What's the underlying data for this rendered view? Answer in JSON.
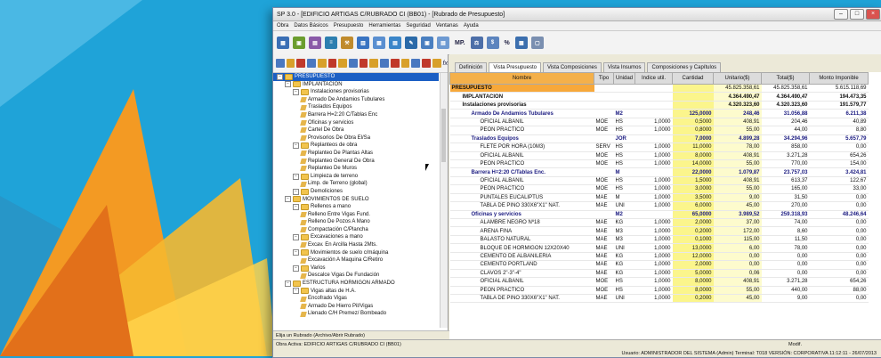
{
  "window": {
    "title": "SP 3.0 - [EDIFICIO ARTIGAS C/RUBRADO CI (BB01) - [Rubrado de Presupuesto]"
  },
  "menu": [
    "Obra",
    "Datos Básicos",
    "Presupuesto",
    "Herramientas",
    "Seguridad",
    "Ventanas",
    "Ayuda"
  ],
  "toolbar": {
    "mp_label": "MP.",
    "percent_label": "%"
  },
  "left_toolbar_fx": "fx",
  "tree": [
    {
      "label": "PRESUPUESTO",
      "level": 0,
      "type": "folder",
      "selected": true
    },
    {
      "label": "IMPLANTACION",
      "level": 1,
      "type": "folder"
    },
    {
      "label": "Instalaciones provisorias",
      "level": 2,
      "type": "folder"
    },
    {
      "label": "Armado De Andamios Tubulares",
      "level": 3,
      "type": "item"
    },
    {
      "label": "Traslados Equipos",
      "level": 3,
      "type": "item"
    },
    {
      "label": "Barrera H=2:20 C/Tablas Enc",
      "level": 3,
      "type": "item"
    },
    {
      "label": "Oficinas y servicios",
      "level": 3,
      "type": "item"
    },
    {
      "label": "Cartel De Obra",
      "level": 3,
      "type": "item"
    },
    {
      "label": "Provisorios De Obra El/Sa",
      "level": 3,
      "type": "item"
    },
    {
      "label": "Replanteos de obra",
      "level": 2,
      "type": "folder"
    },
    {
      "label": "Replanteo De Plantas Altas",
      "level": 3,
      "type": "item"
    },
    {
      "label": "Replanteo General De Obra",
      "level": 3,
      "type": "item"
    },
    {
      "label": "Replanteo De Muros",
      "level": 3,
      "type": "item"
    },
    {
      "label": "Limpieza de terreno",
      "level": 2,
      "type": "folder"
    },
    {
      "label": "Limp. de Terreno (global)",
      "level": 3,
      "type": "item"
    },
    {
      "label": "Demoliciones",
      "level": 2,
      "type": "folder"
    },
    {
      "label": "MOVIMIENTOS DE SUELO",
      "level": 1,
      "type": "folder"
    },
    {
      "label": "Rellenos a mano",
      "level": 2,
      "type": "folder"
    },
    {
      "label": "Relleno Entre Vigas Fund.",
      "level": 3,
      "type": "item"
    },
    {
      "label": "Relleno De Pozos A Mano",
      "level": 3,
      "type": "item"
    },
    {
      "label": "Compactación C/Plancha",
      "level": 3,
      "type": "item"
    },
    {
      "label": "Excavaciones a mano",
      "level": 2,
      "type": "folder"
    },
    {
      "label": "Excav. En Arcilla Hasta 2Mts.",
      "level": 3,
      "type": "item"
    },
    {
      "label": "Movimientos de suelo c/máquina",
      "level": 2,
      "type": "folder"
    },
    {
      "label": "Excavación A Maquina C/Retiro",
      "level": 3,
      "type": "item"
    },
    {
      "label": "Varios",
      "level": 2,
      "type": "folder"
    },
    {
      "label": "Descalce Vigas De Fundación",
      "level": 3,
      "type": "item"
    },
    {
      "label": "ESTRUCTURA HORMIGON ARMADO",
      "level": 1,
      "type": "folder"
    },
    {
      "label": "Vigas altas de H.A.",
      "level": 2,
      "type": "folder"
    },
    {
      "label": "Encofrado Vigas",
      "level": 3,
      "type": "item"
    },
    {
      "label": "Armado De Hierro Pil/Vigas",
      "level": 3,
      "type": "item"
    },
    {
      "label": "Llenado C/H Premez/ Bombeado",
      "level": 3,
      "type": "item"
    }
  ],
  "left_status": "Elija un Rubrado (Archivo/Abrir Rubrado)",
  "tabs": [
    "Definición",
    "Vista Presupuesto",
    "Vista Composiciones",
    "Vista Insumos",
    "Composiciones y Capítulos"
  ],
  "columns": [
    "Nombre",
    "Tipo",
    "Unidad",
    "Indice util.",
    "Cantidad",
    "Unitario($)",
    "Total($)",
    "Monto Imponible"
  ],
  "rows": [
    {
      "style": "head",
      "name": "PRESUPUESTO",
      "tipo": "",
      "unidad": "",
      "indice": "",
      "cantidad": "",
      "unitario": "45.825.358,61",
      "total": "45.825.358,61",
      "monto": "5.615.118,69"
    },
    {
      "style": "b1",
      "name": "IMPLANTACION",
      "tipo": "",
      "unidad": "",
      "indice": "",
      "cantidad": "",
      "unitario": "4.364.490,47",
      "total": "4.364.490,47",
      "monto": "194.473,35"
    },
    {
      "style": "b1",
      "name": "Instalaciones provisorias",
      "tipo": "",
      "unidad": "",
      "indice": "",
      "cantidad": "",
      "unitario": "4.320.323,60",
      "total": "4.320.323,60",
      "monto": "191.579,77"
    },
    {
      "style": "b2",
      "name": "Armado De Andamios Tubulares",
      "tipo": "",
      "unidad": "M2",
      "indice": "",
      "cantidad": "125,0000",
      "unitario": "248,46",
      "total": "31.056,88",
      "monto": "6.211,38"
    },
    {
      "style": "",
      "name": "OFICIAL ALBAÑIL",
      "tipo": "MOE",
      "unidad": "HS",
      "indice": "1,0000",
      "cantidad": "0,5000",
      "unitario": "408,91",
      "total": "204,46",
      "monto": "40,89"
    },
    {
      "style": "",
      "name": "PEON PRACTICO",
      "tipo": "MOE",
      "unidad": "HS",
      "indice": "1,0000",
      "cantidad": "0,8000",
      "unitario": "55,00",
      "total": "44,00",
      "monto": "8,80"
    },
    {
      "style": "b2",
      "name": "Traslados Equipos",
      "tipo": "",
      "unidad": "JOR",
      "indice": "",
      "cantidad": "7,0000",
      "unitario": "4.899,28",
      "total": "34.294,96",
      "monto": "5.657,79"
    },
    {
      "style": "",
      "name": "FLETE POR HORA (10M3)",
      "tipo": "SERV",
      "unidad": "HS",
      "indice": "1,0000",
      "cantidad": "11,0000",
      "unitario": "78,00",
      "total": "858,00",
      "monto": "0,00"
    },
    {
      "style": "",
      "name": "OFICIAL ALBAÑIL",
      "tipo": "MOE",
      "unidad": "HS",
      "indice": "1,0000",
      "cantidad": "8,0000",
      "unitario": "408,91",
      "total": "3.271,28",
      "monto": "654,26"
    },
    {
      "style": "",
      "name": "PEON PRACTICO",
      "tipo": "MOE",
      "unidad": "HS",
      "indice": "1,0000",
      "cantidad": "14,0000",
      "unitario": "55,00",
      "total": "770,00",
      "monto": "154,00"
    },
    {
      "style": "b2",
      "name": "Barrera H=2:20 C/Tablas Enc.",
      "tipo": "",
      "unidad": "M",
      "indice": "",
      "cantidad": "22,0000",
      "unitario": "1.079,87",
      "total": "23.757,03",
      "monto": "3.424,81"
    },
    {
      "style": "",
      "name": "OFICIAL ALBAÑIL",
      "tipo": "MOE",
      "unidad": "HS",
      "indice": "1,0000",
      "cantidad": "1,5000",
      "unitario": "408,91",
      "total": "613,37",
      "monto": "122,67"
    },
    {
      "style": "",
      "name": "PEON PRACTICO",
      "tipo": "MOE",
      "unidad": "HS",
      "indice": "1,0000",
      "cantidad": "3,0000",
      "unitario": "55,00",
      "total": "165,00",
      "monto": "33,00"
    },
    {
      "style": "",
      "name": "PUNTALES EUCALIPTUS",
      "tipo": "MAE",
      "unidad": "M",
      "indice": "1,0000",
      "cantidad": "3,5000",
      "unitario": "9,00",
      "total": "31,50",
      "monto": "0,00"
    },
    {
      "style": "",
      "name": "TABLA DE PINO 330X6\"X1\" NAT.",
      "tipo": "MAE",
      "unidad": "UNI",
      "indice": "1,0000",
      "cantidad": "6,0000",
      "unitario": "45,00",
      "total": "270,00",
      "monto": "0,00"
    },
    {
      "style": "b2",
      "name": "Oficinas y servicios",
      "tipo": "",
      "unidad": "M2",
      "indice": "",
      "cantidad": "65,0000",
      "unitario": "3.989,52",
      "total": "259.318,93",
      "monto": "48.246,64"
    },
    {
      "style": "",
      "name": "ALAMBRE NEGRO Nº18",
      "tipo": "MAE",
      "unidad": "KG",
      "indice": "1,0000",
      "cantidad": "2,0000",
      "unitario": "37,00",
      "total": "74,00",
      "monto": "0,00"
    },
    {
      "style": "",
      "name": "ARENA FINA",
      "tipo": "MAE",
      "unidad": "M3",
      "indice": "1,0000",
      "cantidad": "0,2000",
      "unitario": "172,00",
      "total": "8,60",
      "monto": "0,00"
    },
    {
      "style": "",
      "name": "BALASTO NATURAL",
      "tipo": "MAE",
      "unidad": "M3",
      "indice": "1,0000",
      "cantidad": "0,1000",
      "unitario": "115,00",
      "total": "11,50",
      "monto": "0,00"
    },
    {
      "style": "",
      "name": "BLOQUE DE HORMIGON 12X20X40",
      "tipo": "MAE",
      "unidad": "UNI",
      "indice": "1,0000",
      "cantidad": "13,0000",
      "unitario": "6,00",
      "total": "78,00",
      "monto": "0,00"
    },
    {
      "style": "",
      "name": "CEMENTO DE ALBAÑILERIA",
      "tipo": "MAE",
      "unidad": "KG",
      "indice": "1,0000",
      "cantidad": "12,0000",
      "unitario": "0,00",
      "total": "0,00",
      "monto": "0,00"
    },
    {
      "style": "",
      "name": "CEMENTO PORTLAND",
      "tipo": "MAE",
      "unidad": "KG",
      "indice": "1,0000",
      "cantidad": "2,0000",
      "unitario": "0,00",
      "total": "0,00",
      "monto": "0,00"
    },
    {
      "style": "",
      "name": "CLAVOS 2\"-3\"-4\"",
      "tipo": "MAE",
      "unidad": "KG",
      "indice": "1,0000",
      "cantidad": "5,0000",
      "unitario": "0,06",
      "total": "0,00",
      "monto": "0,00"
    },
    {
      "style": "",
      "name": "OFICIAL ALBAÑIL",
      "tipo": "MOE",
      "unidad": "HS",
      "indice": "1,0000",
      "cantidad": "8,0000",
      "unitario": "408,91",
      "total": "3.271,28",
      "monto": "654,26"
    },
    {
      "style": "",
      "name": "PEON PRACTICO",
      "tipo": "MOE",
      "unidad": "HS",
      "indice": "1,0000",
      "cantidad": "8,0000",
      "unitario": "55,00",
      "total": "440,00",
      "monto": "88,00"
    },
    {
      "style": "",
      "name": "TABLA DE PINO 330X6\"X1\" NAT.",
      "tipo": "MAE",
      "unidad": "UNI",
      "indice": "1,0000",
      "cantidad": "0,2000",
      "unitario": "45,00",
      "total": "9,00",
      "monto": "0,00"
    }
  ],
  "status_line1": "Obra Activa:  EDIFICIO ARTIGAS C/RUBRADO CI (BB01)",
  "status_modif": "Modif.",
  "status_line2": "Usuario: ADMINISTRADOR DEL SISTEMA (Admin)     Terminal: T018     VERSIÓN: CORPORATIVA  11:12:11 - 26/07/2013",
  "colors": {
    "desktop": "#1fa3d8",
    "accent_orange": "#f08a1c",
    "selection": "#1c5fc4",
    "quantity_yellow": "#fbf58c"
  }
}
